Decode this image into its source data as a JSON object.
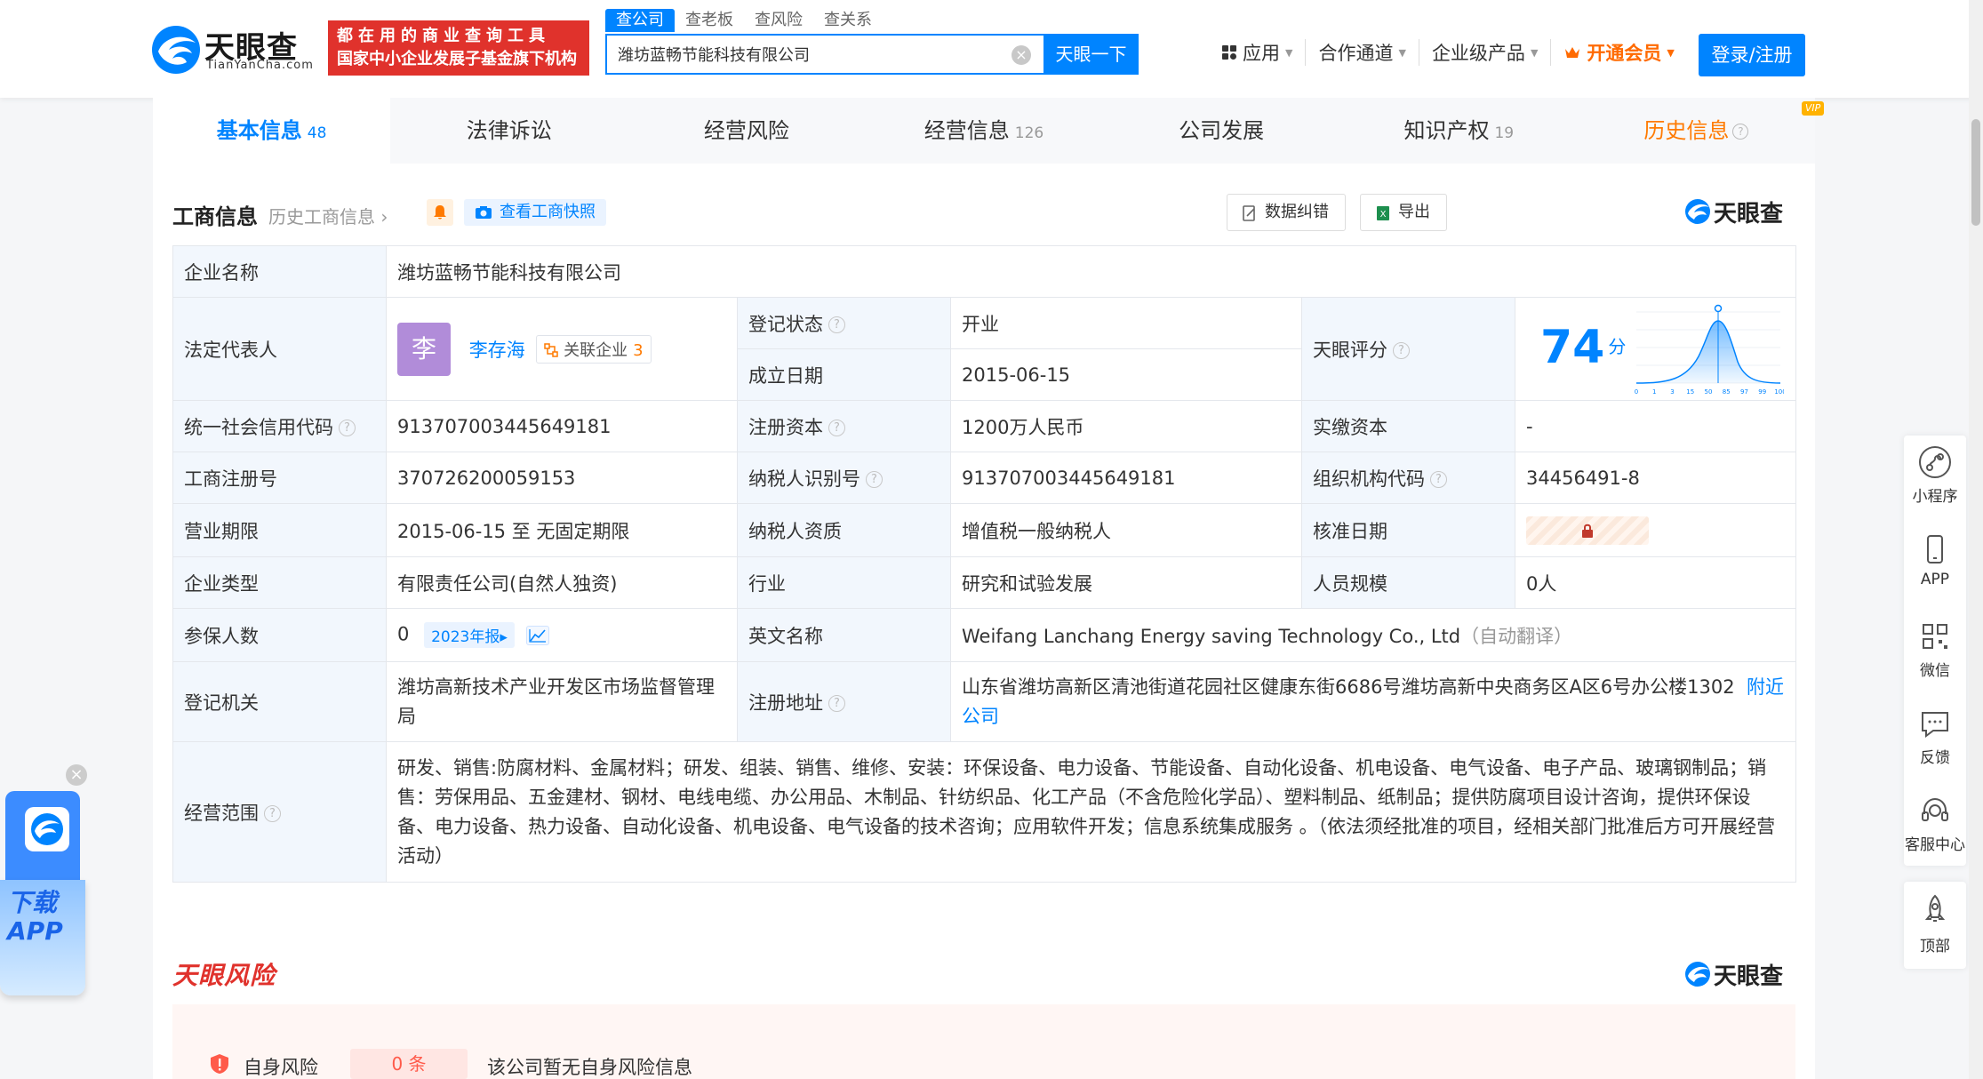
{
  "header": {
    "logo_name": "天眼查",
    "logo_sub": "TianYanCha.com",
    "slogan_line1": "都在用的商业查询工具",
    "slogan_line2": "国家中小企业发展子基金旗下机构",
    "search_tabs": [
      "查公司",
      "查老板",
      "查风险",
      "查关系"
    ],
    "search_value": "潍坊蓝畅节能科技有限公司",
    "search_button": "天眼一下",
    "nav": {
      "apps": "应用",
      "partner": "合作通道",
      "enterprise": "企业级产品",
      "vip": "开通会员"
    },
    "login": "登录/注册"
  },
  "tabs": [
    {
      "label": "基本信息",
      "count": "48"
    },
    {
      "label": "法律诉讼",
      "count": ""
    },
    {
      "label": "经营风险",
      "count": ""
    },
    {
      "label": "经营信息",
      "count": "126"
    },
    {
      "label": "公司发展",
      "count": ""
    },
    {
      "label": "知识产权",
      "count": "19"
    },
    {
      "label": "历史信息",
      "count": ""
    }
  ],
  "history_vip_tag": "VIP",
  "section": {
    "title": "工商信息",
    "history_link": "历史工商信息",
    "snapshot": "查看工商快照",
    "correct": "数据纠错",
    "export": "导出",
    "brand": "天眼查"
  },
  "info": {
    "company_name_label": "企业名称",
    "company_name": "潍坊蓝畅节能科技有限公司",
    "legal_rep_label": "法定代表人",
    "legal_rep_avatar": "李",
    "legal_rep_name": "李存海",
    "related_label": "关联企业",
    "related_count": "3",
    "reg_status_label": "登记状态",
    "reg_status": "开业",
    "est_date_label": "成立日期",
    "est_date": "2015-06-15",
    "score_label": "天眼评分",
    "score": "74",
    "score_unit": "分",
    "credit_code_label": "统一社会信用代码",
    "credit_code": "913707003445649181",
    "reg_capital_label": "注册资本",
    "reg_capital": "1200万人民币",
    "paid_capital_label": "实缴资本",
    "paid_capital": "-",
    "reg_no_label": "工商注册号",
    "reg_no": "370726200059153",
    "taxpayer_id_label": "纳税人识别号",
    "taxpayer_id": "913707003445649181",
    "org_code_label": "组织机构代码",
    "org_code": "34456491-8",
    "term_label": "营业期限",
    "term": "2015-06-15 至 无固定期限",
    "taxpayer_qual_label": "纳税人资质",
    "taxpayer_qual": "增值税一般纳税人",
    "approval_date_label": "核准日期",
    "type_label": "企业类型",
    "type": "有限责任公司(自然人独资)",
    "industry_label": "行业",
    "industry": "研究和试验发展",
    "staff_label": "人员规模",
    "staff": "0人",
    "insured_label": "参保人数",
    "insured": "0",
    "insured_year": "2023年报",
    "english_label": "英文名称",
    "english": "Weifang Lanchang Energy saving Technology Co., Ltd",
    "english_note": "（自动翻译）",
    "authority_label": "登记机关",
    "authority": "潍坊高新技术产业开发区市场监督管理局",
    "address_label": "注册地址",
    "address": "山东省潍坊高新区清池街道花园社区健康东街6686号潍坊高新中央商务区A区6号办公楼1302",
    "nearby": "附近公司",
    "scope_label": "经营范围",
    "scope": "研发、销售:防腐材料、金属材料；研发、组装、销售、维修、安装：环保设备、电力设备、节能设备、自动化设备、机电设备、电气设备、电子产品、玻璃钢制品；销售：劳保用品、五金建材、钢材、电线电缆、办公用品、木制品、针纺织品、化工产品（不含危险化学品）、塑料制品、纸制品；提供防腐项目设计咨询，提供环保设备、电力设备、热力设备、自动化设备、机电设备、电气设备的技术咨询；应用软件开发；信息系统集成服务 。（依法须经批准的项目，经相关部门批准后方可开展经营活动）"
  },
  "score_axis": [
    "0",
    "1",
    "3",
    "15",
    "50",
    "85",
    "97",
    "99",
    "100"
  ],
  "risk": {
    "title": "天眼风险",
    "brand": "天眼查",
    "self_label": "自身风险",
    "self_count": "0 条",
    "self_msg": "该公司暂无自身风险信息"
  },
  "float": {
    "mini": "小程序",
    "app": "APP",
    "wechat": "微信",
    "feedback": "反馈",
    "service": "客服中心",
    "top": "顶部"
  },
  "download": {
    "line1": "下载",
    "line2": "APP"
  },
  "colors": {
    "primary": "#0084ff",
    "brand_red": "#e0322c",
    "open_green": "#19b955",
    "vip_orange": "#ff7a00"
  }
}
